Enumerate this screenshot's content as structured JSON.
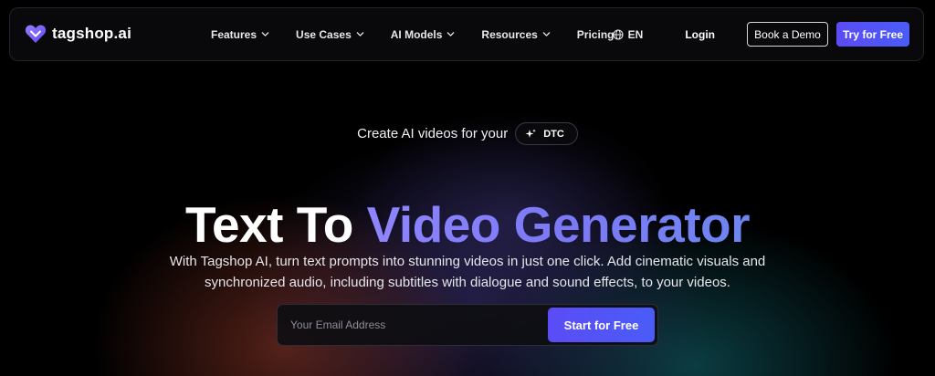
{
  "brand": {
    "name": "tagshop.ai",
    "logo_icon": "heart-logo-icon",
    "accent": "#5b4cf5"
  },
  "nav": {
    "items": [
      {
        "label": "Features",
        "has_dropdown": true
      },
      {
        "label": "Use Cases",
        "has_dropdown": true
      },
      {
        "label": "AI Models",
        "has_dropdown": true
      },
      {
        "label": "Resources",
        "has_dropdown": true
      },
      {
        "label": "Pricing",
        "has_dropdown": false
      }
    ],
    "language": "EN",
    "login_label": "Login",
    "demo_label": "Book a Demo",
    "try_label": "Try for Free"
  },
  "hero": {
    "tagline": "Create AI videos for your",
    "pill_label": "DTC",
    "pill_icon": "sparkle-icon",
    "headline_white": "Text To",
    "headline_accent": "Video Generator",
    "subtitle_line1": "With Tagshop AI, turn text prompts into stunning videos in just one click. Add cinematic visuals and",
    "subtitle_line2": "synchronized audio, including subtitles with dialogue and sound effects, to your videos.",
    "email_placeholder": "Your Email Address",
    "email_value": "",
    "cta_label": "Start for Free"
  }
}
